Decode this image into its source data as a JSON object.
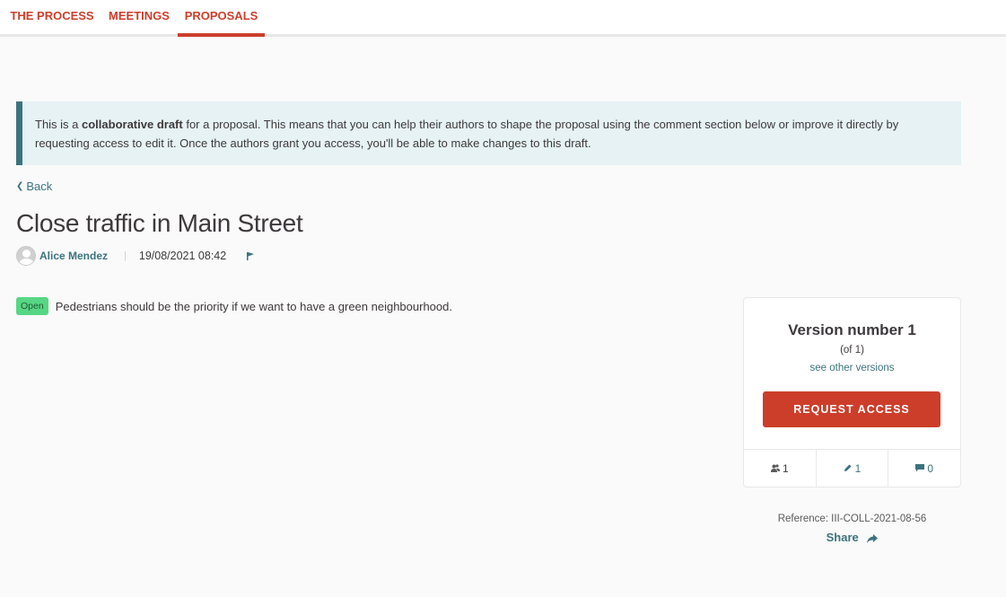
{
  "nav": {
    "tabs": [
      {
        "label": "THE PROCESS",
        "active": false
      },
      {
        "label": "MEETINGS",
        "active": false
      },
      {
        "label": "PROPOSALS",
        "active": true
      }
    ]
  },
  "callout": {
    "prefix": "This is a ",
    "bold": "collaborative draft",
    "suffix": " for a proposal. This means that you can help their authors to shape the proposal using the comment section below or improve it directly by requesting access to edit it. Once the authors grant you access, you'll be able to make changes to this draft."
  },
  "back_label": "Back",
  "proposal": {
    "title": "Close traffic in Main Street",
    "author": "Alice Mendez",
    "separator": "|",
    "date": "19/08/2021 08:42",
    "status": "Open",
    "body": "Pedestrians should be the priority if we want to have a green neighbourhood."
  },
  "version_card": {
    "title": "Version number 1",
    "of": "(of 1)",
    "link": "see other versions",
    "button": "REQUEST ACCESS",
    "stats": {
      "authors": "1",
      "versions": "1",
      "comments": "0"
    }
  },
  "reference": "Reference: III-COLL-2021-08-56",
  "share_label": "Share",
  "colors": {
    "accent": "#cc3e2a",
    "secondary": "#3b737e",
    "status_open": "#57d684",
    "callout_bg": "#e6f2f4"
  }
}
